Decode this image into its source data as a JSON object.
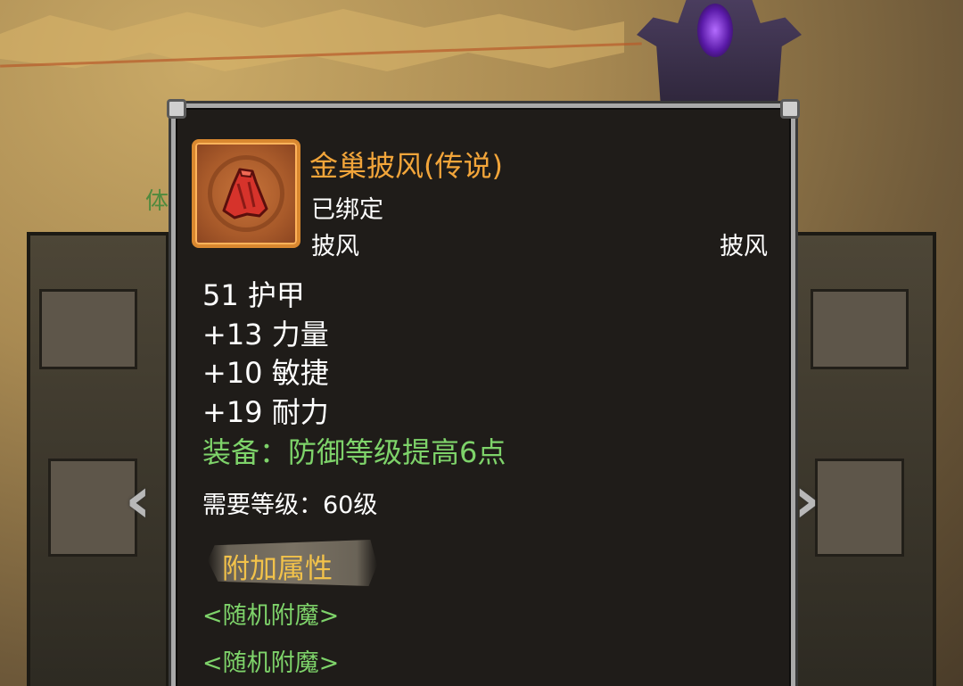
{
  "background": {
    "side_label": "体",
    "nav_left": "‹",
    "nav_right": "›"
  },
  "item": {
    "icon": "red-cape-icon",
    "name": "金巢披风(传说)",
    "bound": "已绑定",
    "slot": "披风",
    "type": "披风",
    "stats": [
      "51 护甲",
      "+13 力量",
      "+10 敏捷",
      "+19 耐力"
    ],
    "equip_effect": "装备：防御等级提高6点",
    "required_level": "需要等级：60级",
    "extra_header": "附加属性",
    "enchants": [
      "<随机附魔>",
      "<随机附魔>"
    ]
  },
  "colors": {
    "legendary": "#f2a53a",
    "equip_green": "#7ed36a",
    "header_gold": "#f2c24a"
  }
}
